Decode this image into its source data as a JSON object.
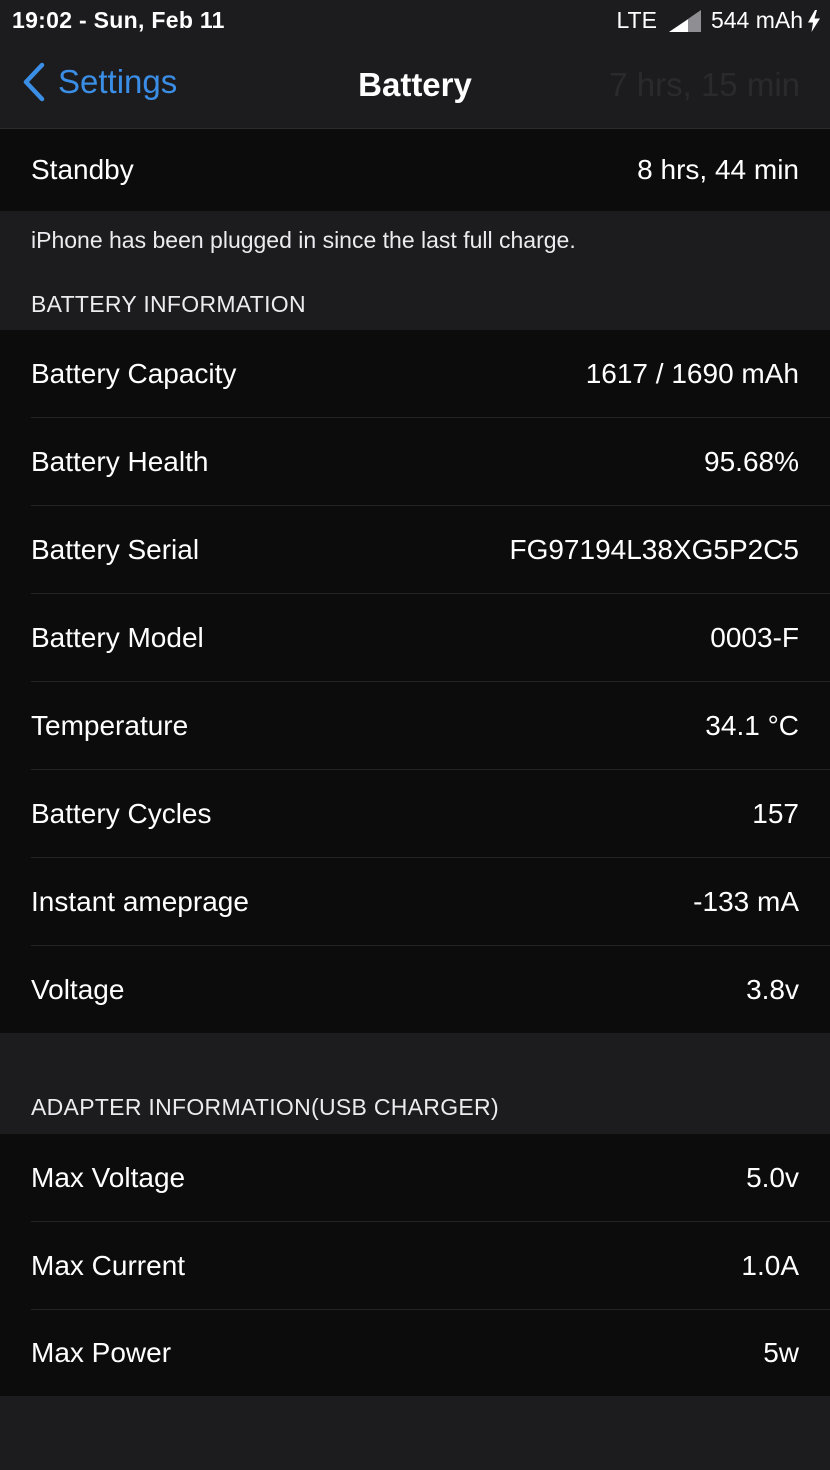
{
  "status_bar": {
    "time": "19:02 - Sun, Feb 11",
    "carrier": "LTE",
    "battery_text": "544 mAh"
  },
  "nav": {
    "back_label": "Settings",
    "title": "Battery",
    "faded_text": "7 hrs, 15 min"
  },
  "standby": {
    "label": "Standby",
    "value": "8 hrs, 44 min"
  },
  "footnote": "iPhone has been plugged in since the last full charge.",
  "battery_info": {
    "header": "BATTERY INFORMATION",
    "rows": [
      {
        "label": "Battery Capacity",
        "value": "1617 / 1690 mAh"
      },
      {
        "label": "Battery Health",
        "value": "95.68%"
      },
      {
        "label": "Battery Serial",
        "value": "FG97194L38XG5P2C5"
      },
      {
        "label": "Battery Model",
        "value": "0003-F"
      },
      {
        "label": "Temperature",
        "value": "34.1 °C"
      },
      {
        "label": "Battery Cycles",
        "value": "157"
      },
      {
        "label": "Instant ameprage",
        "value": "-133 mA"
      },
      {
        "label": "Voltage",
        "value": "3.8v"
      }
    ]
  },
  "adapter_info": {
    "header": "ADAPTER INFORMATION(USB CHARGER)",
    "rows": [
      {
        "label": "Max Voltage",
        "value": "5.0v"
      },
      {
        "label": "Max Current",
        "value": "1.0A"
      },
      {
        "label": "Max Power",
        "value": "5w"
      }
    ]
  },
  "colors": {
    "accent": "#3a8ee6",
    "background": "#1c1c1e",
    "cell_background": "#0c0c0d"
  }
}
